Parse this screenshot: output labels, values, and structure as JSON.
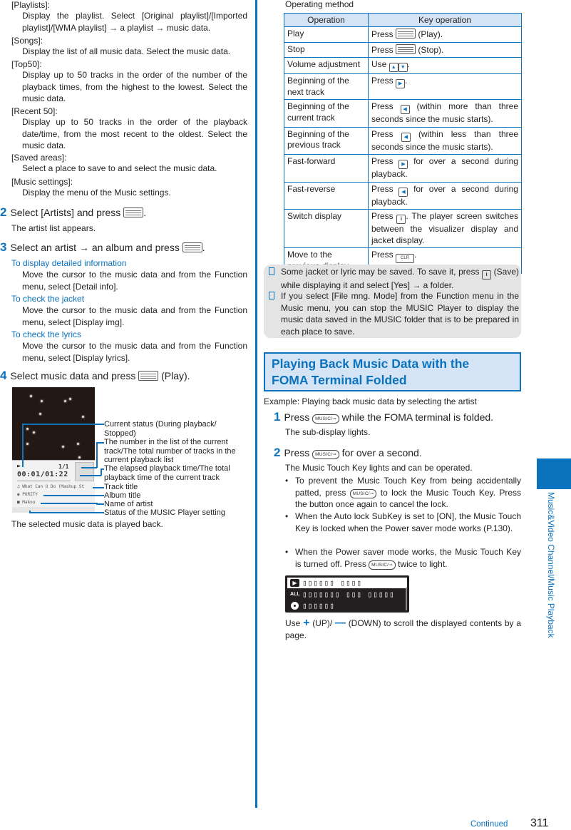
{
  "left": {
    "menu_items": [
      {
        "term": "[Playlists]:",
        "desc": "Display the playlist. Select [Original playlist]/[Imported playlist]/[WMA playlist] → a playlist → music data."
      },
      {
        "term": "[Songs]:",
        "desc": "Display the list of all music data. Select the music data."
      },
      {
        "term": "[Top50]:",
        "desc": "Display up to 50 tracks in the order of the number of the playback times, from the highest to the lowest. Select the music data."
      },
      {
        "term": "[Recent 50]:",
        "desc": "Display up to 50 tracks in the order of the playback date/time, from the most recent to the oldest. Select the music data."
      },
      {
        "term": "[Saved areas]:",
        "desc": "Select a place to save to and select the music data."
      },
      {
        "term": "[Music settings]:",
        "desc": "Display the menu of the Music settings."
      }
    ],
    "step2": {
      "num": "2",
      "text": "Select [Artists] and press",
      "after": ".",
      "result": "The artist list appears."
    },
    "step3": {
      "num": "3",
      "text": "Select an artist → an album and press",
      "after": "."
    },
    "tips": [
      {
        "title": "To display detailed information",
        "desc": "Move the cursor to the music data and from the Function menu, select [Detail info]."
      },
      {
        "title": "To check the jacket",
        "desc": "Move the cursor to the music data and from the Function menu, select [Display img]."
      },
      {
        "title": "To check the lyrics",
        "desc": "Move the cursor to the music data and from the Function menu, select [Display lyrics]."
      }
    ],
    "step4": {
      "num": "4",
      "text": "Select music data and press",
      "after": "(Play).",
      "result": "The selected music data is played back."
    },
    "phone_screen": {
      "status_symbol": "►",
      "track_count": "1/1",
      "time": "00:01/01:22",
      "track_title": "What Can U Do (Mashup St",
      "album_title": "PURITY",
      "artist": "Makou"
    },
    "callouts": [
      "Current status (During playback/ Stopped)",
      "The number in the list of the current track/The total number of tracks in the current playback list",
      "The elapsed playback time/The total playback time of the current track",
      "Track title",
      "Album title",
      "Name of artist",
      "Status of the MUSIC Player setting"
    ]
  },
  "right": {
    "table_caption": "Operating method",
    "table_headers": [
      "Operation",
      "Key operation"
    ],
    "table_rows": [
      {
        "op": "Play",
        "key_pre": "Press",
        "key_icon": "menu-key",
        "key_post": "(Play)."
      },
      {
        "op": "Stop",
        "key_pre": "Press",
        "key_icon": "menu-key",
        "key_post": "(Stop)."
      },
      {
        "op": "Volume adjustment",
        "key_pre": "Use",
        "key_icon": "up-down-keys",
        "key_post": "."
      },
      {
        "op": "Beginning of the next track",
        "key_pre": "Press",
        "key_icon": "right-key",
        "key_post": "."
      },
      {
        "op": "Beginning of the current track",
        "key_pre": "Press",
        "key_icon": "left-key",
        "key_post": "(within more than three seconds since the music starts)."
      },
      {
        "op": "Beginning of the previous track",
        "key_pre": "Press",
        "key_icon": "left-key",
        "key_post": "(within less than three seconds since the music starts)."
      },
      {
        "op": "Fast-forward",
        "key_pre": "Press",
        "key_icon": "right-key",
        "key_post": "for over a second during playback."
      },
      {
        "op": "Fast-reverse",
        "key_pre": "Press",
        "key_icon": "left-key",
        "key_post": "for over a second during playback."
      },
      {
        "op": "Switch display",
        "key_pre": "Press",
        "key_icon": "i-key",
        "key_post": ". The player screen switches between the visualizer display and jacket display."
      },
      {
        "op": "Move to the previous display",
        "key_pre": "Press",
        "key_icon": "clr-key",
        "key_post": "."
      }
    ],
    "notes": [
      {
        "pre": "Some jacket or lyric may be saved. To save it, press",
        "post": "(Save) while displaying it and select [Yes] → a folder."
      },
      {
        "pre": "If you select [File mng. Mode] from the Function menu in the Music menu, you can stop the MUSIC Player to display the music data saved in the MUSIC folder that is to be prepared in each place to save.",
        "post": ""
      }
    ],
    "section_title_line1": "Playing Back Music Data with the",
    "section_title_line2": "FOMA Terminal Folded",
    "example": "Example: Playing back music data by selecting the artist",
    "step1": {
      "num": "1",
      "pre": "Press",
      "post": "while the FOMA terminal is folded.",
      "result": "The sub-display lights."
    },
    "step2": {
      "num": "2",
      "pre": "Press",
      "post": "for over a second.",
      "result": "The Music Touch Key lights and can be operated."
    },
    "bullets": [
      {
        "pre": "To prevent the Music Touch Key from being accidentally patted, press",
        "post": "to lock the Music Touch Key. Press the button once again to cancel the lock."
      },
      {
        "pre": "When the Auto lock SubKey is set to [ON], the Music Touch Key is locked when the Power saver mode works (P.130).",
        "post": ""
      },
      {
        "pre": "When the Power saver mode works, the Music Touch Key is turned off. Press",
        "post": "twice to light."
      }
    ],
    "music_key_label": "MUSIC/⊸",
    "subdisplay_rows": [
      "▯▯▯▯▯▯ ▯▯▯▯",
      "▯▯▯▯▯▯▯ ▯▯▯ ▯▯▯▯▯",
      "▯▯▯▯▯▯"
    ],
    "scroll_text_pre": "Use",
    "scroll_up": "(UP)/",
    "scroll_down": "(DOWN) to scroll the displayed contents by a page."
  },
  "side_tab": {
    "label": "Music&Video Channel/Music Playback"
  },
  "footer": {
    "continued": "Continued",
    "page_number": "311"
  },
  "colors": {
    "accent": "#0b72bd",
    "header_bg": "#d5e4f5",
    "note_bg": "#e4e4e4"
  }
}
